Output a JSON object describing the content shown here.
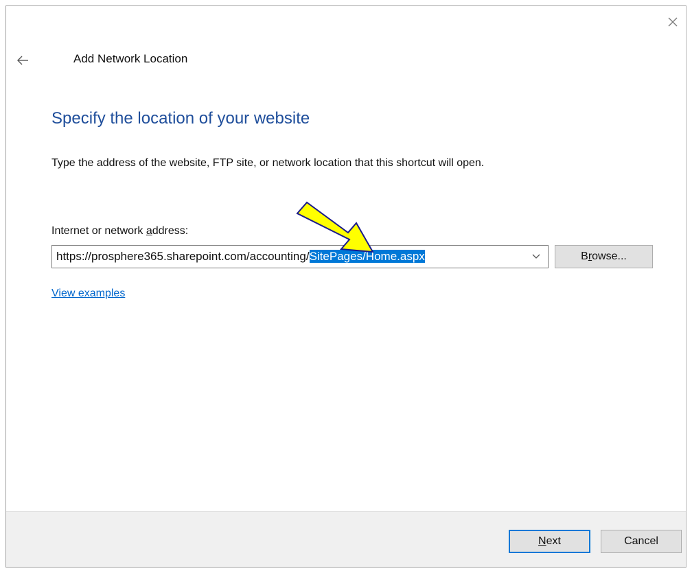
{
  "window": {
    "title": "Add Network Location",
    "back_icon": "back-arrow-icon",
    "close_icon": "close-icon"
  },
  "page": {
    "heading": "Specify the location of your website",
    "instructions": "Type the address of the website, FTP site, or network location that this shortcut will open."
  },
  "address": {
    "label": "Internet or network address:",
    "value_prefix": "https://prosphere365.sharepoint.com/accounting/",
    "value_selected": "SitePages/Home.aspx",
    "dropdown_icon": "chevron-down-icon"
  },
  "browse_button": {
    "label": "Browse..."
  },
  "examples_link": {
    "label": "View examples"
  },
  "footer": {
    "next_label": "Next",
    "cancel_label": "Cancel"
  },
  "annotation": {
    "arrow_color": "#ffff00",
    "arrow_outline": "#1a1a8c",
    "selection_color": "#0078d7",
    "heading_color": "#1f4e9b",
    "link_color": "#0066cc"
  }
}
